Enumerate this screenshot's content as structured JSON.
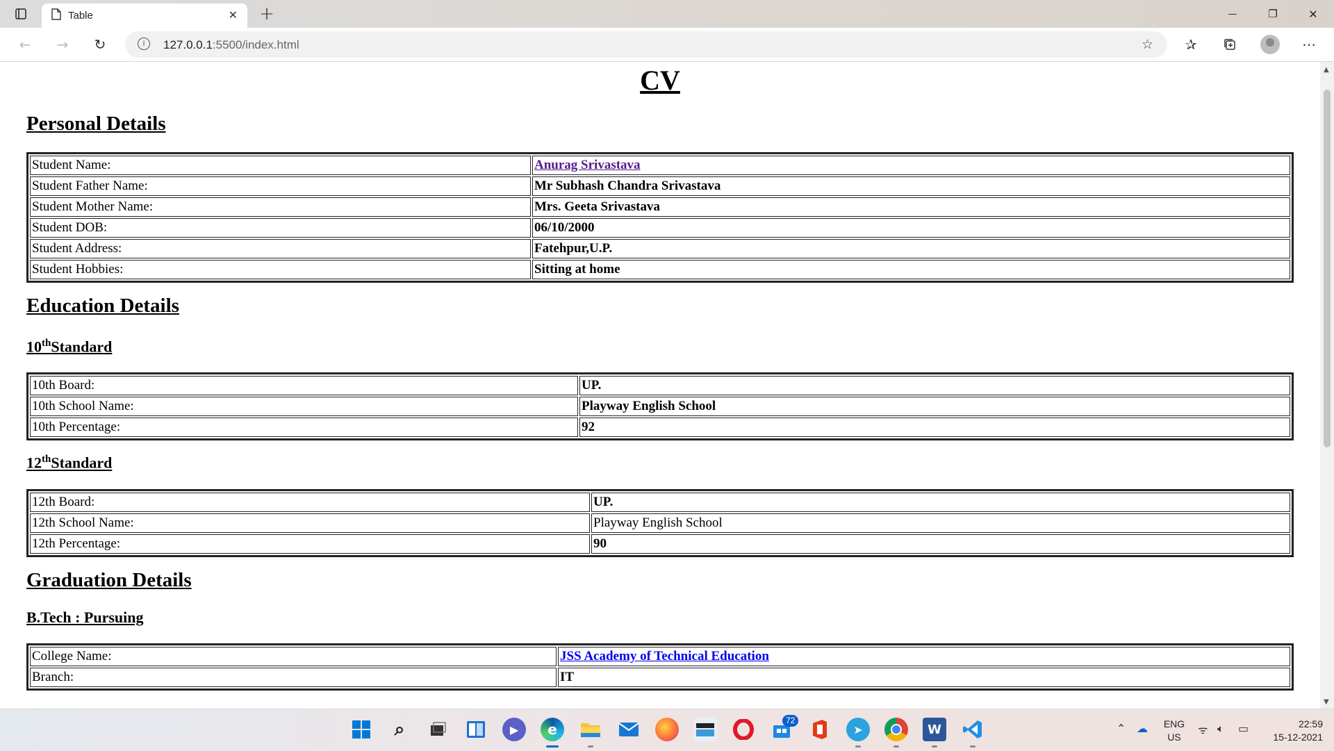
{
  "browser": {
    "tab_title": "Table",
    "tab_close": "✕",
    "new_tab": "+",
    "url_host": "127.0.0.1",
    "url_rest": ":5500/index.html",
    "window_controls": {
      "minimize": "—",
      "maximize": "❐",
      "close": "✕"
    }
  },
  "page": {
    "title": "CV",
    "personal": {
      "heading": "Personal Details",
      "rows": [
        {
          "label": "Student Name:",
          "value": "Anurag Srivastava"
        },
        {
          "label": "Student Father Name:",
          "value": "Mr Subhash Chandra Srivastava"
        },
        {
          "label": "Student Mother Name:",
          "value": "Mrs. Geeta Srivastava"
        },
        {
          "label": "Student DOB:",
          "value": "06/10/2000"
        },
        {
          "label": "Student Address:",
          "value": "Fatehpur,U.P."
        },
        {
          "label": "Student Hobbies:",
          "value": "Sitting at home"
        }
      ]
    },
    "education": {
      "heading": "Education Details",
      "tenth": {
        "num": "10",
        "sup": "th",
        "word": "Standard",
        "rows": [
          {
            "label": "10th Board:",
            "value": "UP."
          },
          {
            "label": "10th School Name:",
            "value": "Playway English School"
          },
          {
            "label": "10th Percentage:",
            "value": "92"
          }
        ]
      },
      "twelfth": {
        "num": "12",
        "sup": "th",
        "word": "Standard",
        "rows": [
          {
            "label": "12th Board:",
            "value": "UP."
          },
          {
            "label": "12th School Name:",
            "value": "Playway English School"
          },
          {
            "label": "12th Percentage:",
            "value": "90"
          }
        ]
      }
    },
    "graduation": {
      "heading": "Graduation Details",
      "sub": "B.Tech : Pursuing",
      "rows": [
        {
          "label": "College Name:",
          "value": "JSS Academy of Technical Education"
        },
        {
          "label": "Branch:",
          "value": "IT"
        }
      ]
    }
  },
  "taskbar": {
    "mail_badge": "72",
    "lang": "ENG",
    "region": "US",
    "time": "22:59",
    "date": "15-12-2021"
  },
  "colors": {
    "link": "#0000ee",
    "visited_link": "#551a8b",
    "windows_blue": "#0078d4"
  }
}
